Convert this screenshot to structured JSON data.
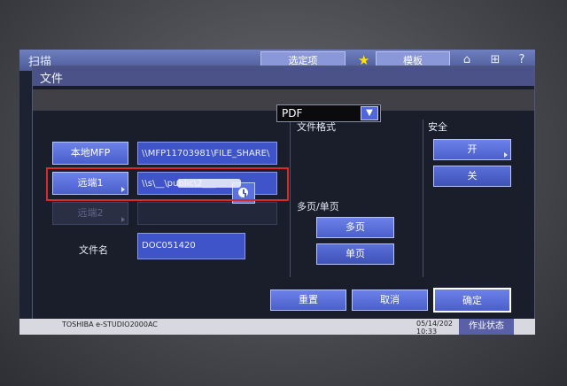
{
  "app": {
    "title": "扫描",
    "tabs": [
      "选定项",
      "模板"
    ]
  },
  "dialog": {
    "title": "文件",
    "destinations": {
      "local_label": "本地MFP",
      "local_path": "\\\\MFP11703981\\FILE_SHARE\\",
      "remote1_label": "远端1",
      "remote1_path": "\\\\s\\__\\public\\2___",
      "remote2_label": "远端2",
      "remote2_path": ""
    },
    "filename": {
      "label": "文件名",
      "value": "DOC051420"
    },
    "format": {
      "heading": "文件格式",
      "selected": "PDF"
    },
    "pages": {
      "heading": "多页/单页",
      "multi": "多页",
      "single": "单页"
    },
    "security": {
      "heading": "安全",
      "on": "开",
      "off": "关"
    },
    "buttons": {
      "reset": "重置",
      "cancel": "取消",
      "ok": "确定"
    }
  },
  "status": {
    "model": "TOSHIBA e-STUDIO2000AC",
    "date": "05/14/202",
    "time": "10:33",
    "job_status": "作业状态"
  }
}
